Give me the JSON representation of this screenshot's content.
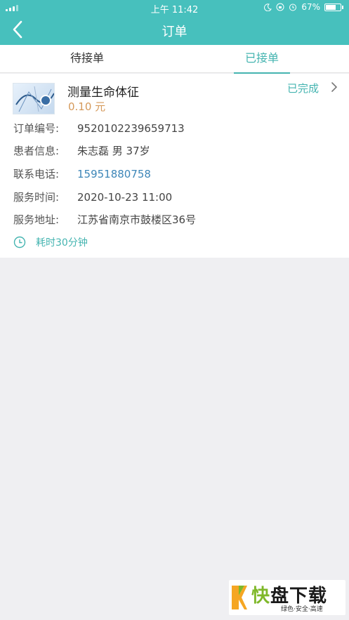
{
  "statusbar": {
    "time": "上午 11:42",
    "battery": "67%"
  },
  "nav": {
    "title": "订单",
    "back_icon": "chevron-left-icon"
  },
  "tabs": [
    {
      "label": "待接单",
      "active": false
    },
    {
      "label": "已接单",
      "active": true
    }
  ],
  "order": {
    "service_name": "测量生命体征",
    "price": "0.10 元",
    "status": "已完成",
    "fields": [
      {
        "label": "订单编号:",
        "value": "9520102239659713"
      },
      {
        "label": "患者信息:",
        "value": "朱志磊 男 37岁"
      },
      {
        "label": "联系电话:",
        "value": "15951880758"
      },
      {
        "label": "服务时间:",
        "value": "2020-10-23 11:00"
      },
      {
        "label": "服务地址:",
        "value": "江苏省南京市鼓楼区36号"
      }
    ],
    "duration": "耗时30分钟"
  },
  "watermark": {
    "title_first": "快",
    "title_rest": "盘下载",
    "subtitle": "绿色·安全·高速"
  },
  "colors": {
    "header": "#47c0bd",
    "accent": "#44b4b0",
    "price": "#d59a5b",
    "phone": "#3d86b8"
  }
}
